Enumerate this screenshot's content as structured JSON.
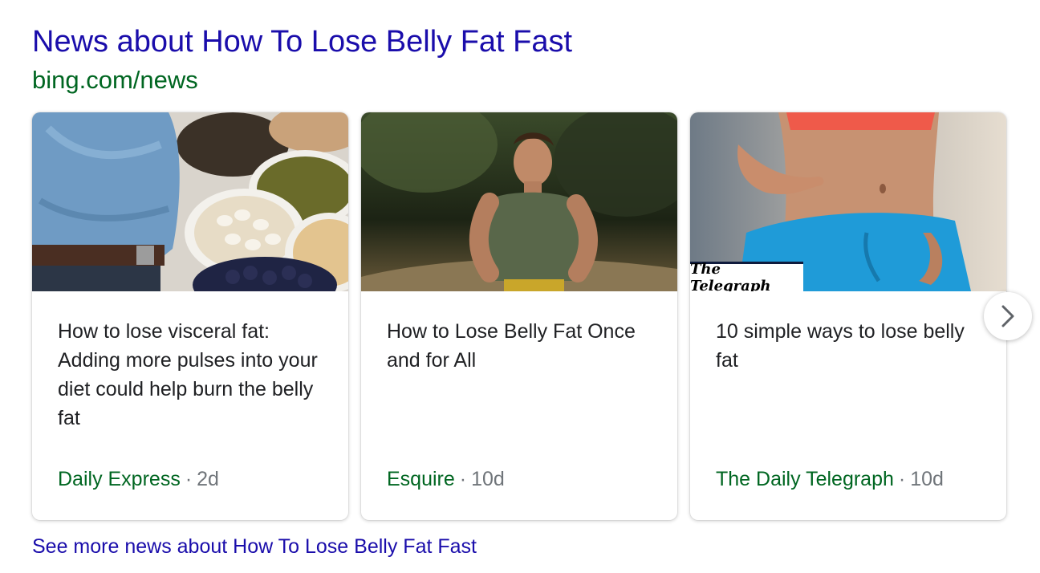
{
  "header": {
    "title": "News about How To Lose Belly Fat Fast",
    "url": "bing.com/news"
  },
  "cards": [
    {
      "headline": "How to lose visceral fat: Adding more pulses into your diet could help burn the belly fat",
      "source": "Daily Express",
      "separator": "·",
      "age": "2d",
      "image": "belly-and-pulses-photo"
    },
    {
      "headline": "How to Lose Belly Fat Once and for All",
      "source": "Esquire",
      "separator": "·",
      "age": "10d",
      "image": "man-running-photo"
    },
    {
      "headline": "10 simple ways to lose belly fat",
      "source": "The Daily Telegraph",
      "separator": "·",
      "age": "10d",
      "image": "woman-midriff-photo",
      "logo_text": "The Telegraph"
    }
  ],
  "carousel": {
    "next_icon": "chevron-right-icon"
  },
  "footer": {
    "see_more": "See more news about How To Lose Belly Fat Fast"
  },
  "colors": {
    "link": "#1a0dab",
    "url_green": "#006621",
    "text": "#202124",
    "muted": "#70757a"
  }
}
